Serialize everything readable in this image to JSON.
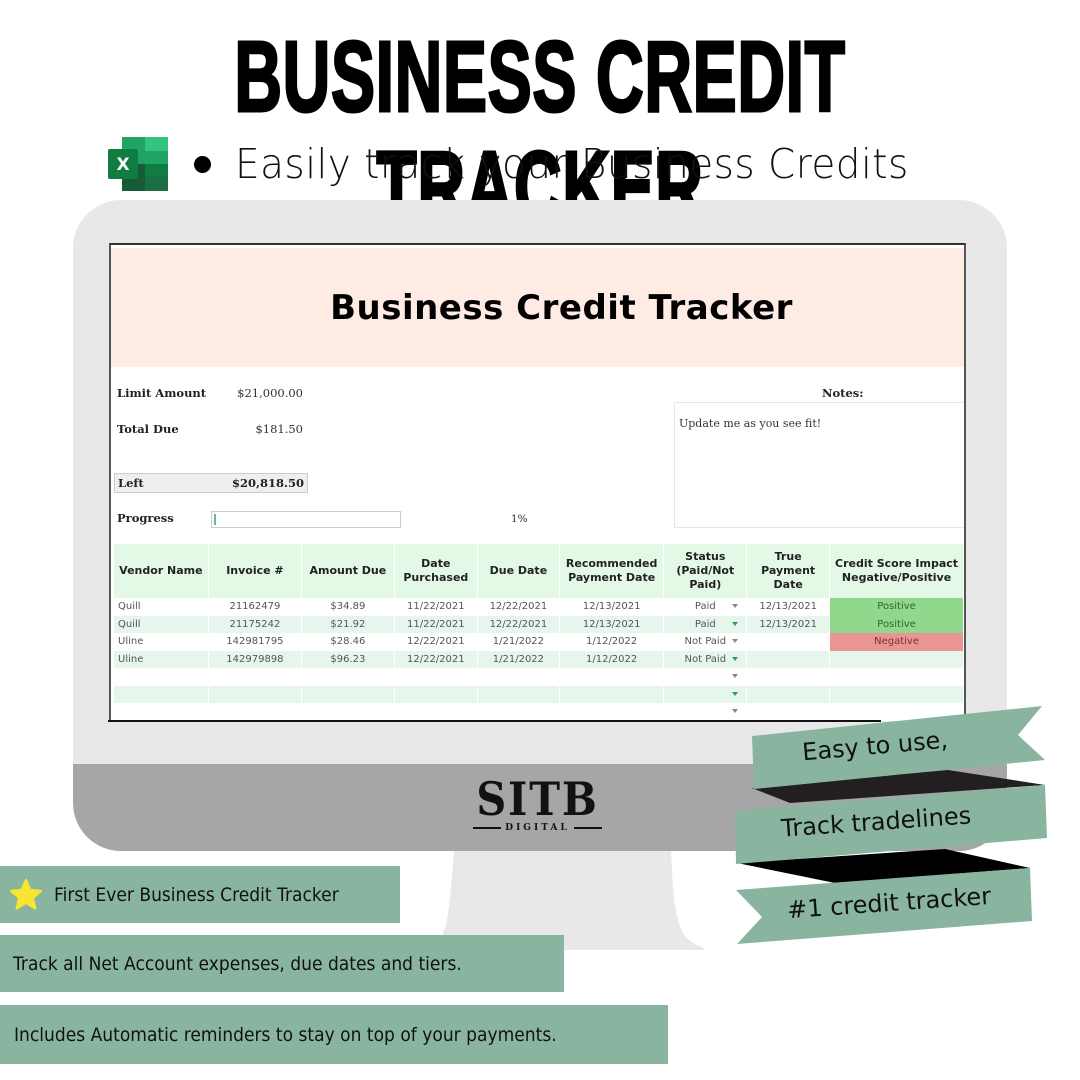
{
  "hero": {
    "title": "BUSINESS CREDIT TRACKER",
    "app_icon": "excel-icon",
    "subtitle": "Easily track your Business Credits"
  },
  "spreadsheet": {
    "title": "Business Credit Tracker",
    "summary": {
      "limit_label": "Limit Amount",
      "limit_value": "$21,000.00",
      "total_due_label": "Total Due",
      "total_due_value": "$181.50",
      "left_label": "Left",
      "left_value": "$20,818.50",
      "progress_label": "Progress",
      "progress_percent": 1,
      "progress_text": "1%"
    },
    "notes": {
      "label": "Notes:",
      "text": "Update me as you see fit!"
    },
    "columns": [
      "Vendor Name",
      "Invoice #",
      "Amount Due",
      "Date Purchased",
      "Due Date",
      "Recommended Payment Date",
      "Status (Paid/Not Paid)",
      "True Payment Date",
      "Credit Score Impact Negative/Positive"
    ],
    "rows": [
      {
        "vendor": "Quill",
        "invoice": "21162479",
        "amount": "$34.89",
        "purchased": "11/22/2021",
        "due": "12/22/2021",
        "recommended": "12/13/2021",
        "status": "Paid",
        "true_date": "12/13/2021",
        "impact": "Positive"
      },
      {
        "vendor": "Quill",
        "invoice": "21175242",
        "amount": "$21.92",
        "purchased": "11/22/2021",
        "due": "12/22/2021",
        "recommended": "12/13/2021",
        "status": "Paid",
        "true_date": "12/13/2021",
        "impact": "Positive"
      },
      {
        "vendor": "Uline",
        "invoice": "142981795",
        "amount": "$28.46",
        "purchased": "12/22/2021",
        "due": "1/21/2022",
        "recommended": "1/12/2022",
        "status": "Not Paid",
        "true_date": "",
        "impact": "Negative"
      },
      {
        "vendor": "Uline",
        "invoice": "142979898",
        "amount": "$96.23",
        "purchased": "12/22/2021",
        "due": "1/21/2022",
        "recommended": "1/12/2022",
        "status": "Not Paid",
        "true_date": "",
        "impact": ""
      }
    ],
    "empty_rows": 4,
    "colors": {
      "title_band": "#fdebe4",
      "header_bg": "#e3f9e6",
      "alt_row": "#e6f6ec",
      "positive": "#8fd88c",
      "negative": "#e99593",
      "progress_fill": "#5fb9a6"
    }
  },
  "brand": {
    "name": "SITB",
    "sub": "DIGITAL"
  },
  "ribbons": [
    "Easy to use,",
    "Track tradelines",
    "#1 credit tracker"
  ],
  "features": [
    {
      "icon": "star-icon",
      "text": "First Ever Business Credit Tracker"
    },
    {
      "icon": "",
      "text": "Track all Net Account expenses, due dates and tiers."
    },
    {
      "icon": "",
      "text": "Includes  Automatic reminders to stay on top of your payments."
    }
  ],
  "theme": {
    "accent_green": "#89b5a0",
    "monitor_frame": "#e8e8e8",
    "monitor_chin": "#a6a6a6"
  }
}
